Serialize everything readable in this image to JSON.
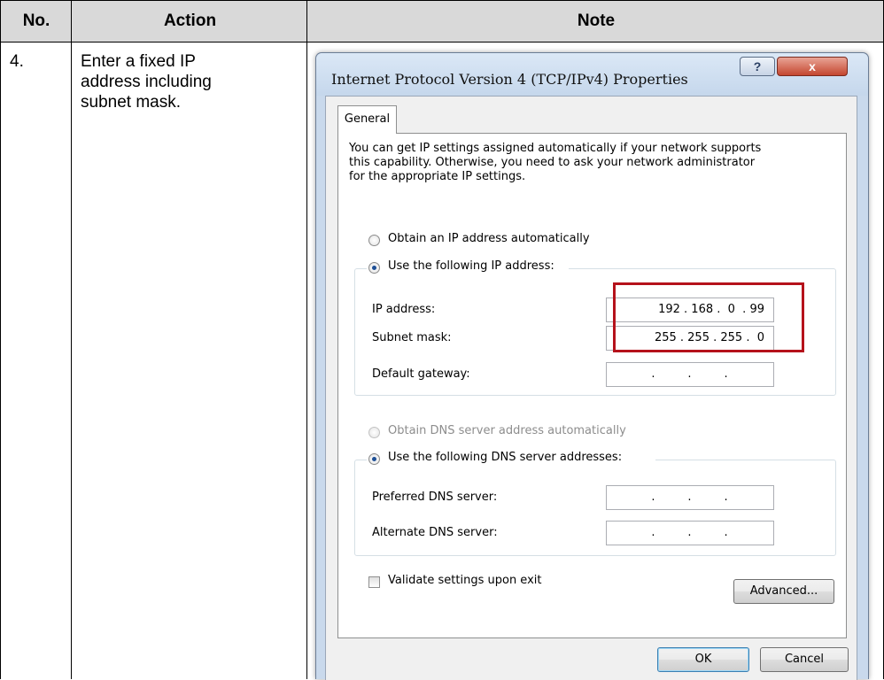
{
  "table": {
    "headers": {
      "no": "No.",
      "action": "Action",
      "note": "Note"
    },
    "rows": [
      {
        "no": "4.",
        "action_lines": [
          "Enter a fixed IP",
          "address including",
          "subnet mask."
        ]
      }
    ]
  },
  "dialog": {
    "title": "Internet Protocol Version 4 (TCP/IPv4) Properties",
    "help_label": "?",
    "close_label": "x",
    "tab_general": "General",
    "description_lines": [
      "You can get IP settings assigned automatically if your network supports",
      "this capability. Otherwise, you need to ask your network administrator",
      "for the appropriate IP settings."
    ],
    "ip_auto_label": "Obtain an IP address automatically",
    "ip_manual_label": "Use the following IP address:",
    "ip_mode": "manual",
    "fields": {
      "ip_address": {
        "label": "IP address:",
        "value": "192 . 168 .  0  . 99"
      },
      "subnet_mask": {
        "label": "Subnet mask:",
        "value": "255 . 255 . 255 .  0"
      },
      "default_gateway": {
        "label": "Default gateway:",
        "value": ".       .       ."
      }
    },
    "dns_auto_label": "Obtain DNS server address automatically",
    "dns_manual_label": "Use the following DNS server addresses:",
    "dns_mode": "manual",
    "dns_fields": {
      "preferred": {
        "label": "Preferred DNS server:",
        "value": ".       .       ."
      },
      "alternate": {
        "label": "Alternate DNS server:",
        "value": ".       .       ."
      }
    },
    "validate_label": "Validate settings upon exit",
    "validate_checked": false,
    "advanced_label": "Advanced...",
    "ok_label": "OK",
    "cancel_label": "Cancel"
  },
  "colors": {
    "highlight": "#b5121b",
    "header_bg": "#d9d9d9",
    "titlebar": "#c9d9ec"
  }
}
